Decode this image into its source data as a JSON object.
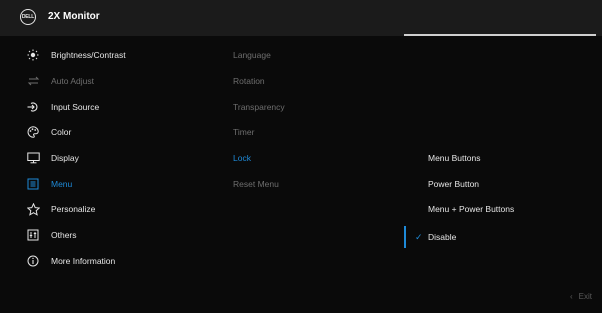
{
  "header": {
    "logo_text": "DELL",
    "title": "2X Monitor"
  },
  "main_menu": [
    {
      "label": "Brightness/Contrast",
      "icon": "brightness-icon",
      "state": "normal"
    },
    {
      "label": "Auto Adjust",
      "icon": "auto-adjust-icon",
      "state": "disabled"
    },
    {
      "label": "Input Source",
      "icon": "input-source-icon",
      "state": "normal"
    },
    {
      "label": "Color",
      "icon": "color-palette-icon",
      "state": "normal"
    },
    {
      "label": "Display",
      "icon": "display-icon",
      "state": "normal"
    },
    {
      "label": "Menu",
      "icon": "menu-icon",
      "state": "selected"
    },
    {
      "label": "Personalize",
      "icon": "star-icon",
      "state": "normal"
    },
    {
      "label": "Others",
      "icon": "others-icon",
      "state": "normal"
    },
    {
      "label": "More Information",
      "icon": "info-icon",
      "state": "normal"
    }
  ],
  "submenu": [
    {
      "label": "Language",
      "state": "dim"
    },
    {
      "label": "Rotation",
      "state": "dim"
    },
    {
      "label": "Transparency",
      "state": "dim"
    },
    {
      "label": "Timer",
      "state": "dim"
    },
    {
      "label": "Lock",
      "state": "selected"
    },
    {
      "label": "Reset Menu",
      "state": "dim"
    }
  ],
  "lock_options": [
    {
      "label": "Menu Buttons",
      "state": "normal"
    },
    {
      "label": "Power Button",
      "state": "normal"
    },
    {
      "label": "Menu + Power Buttons",
      "state": "normal"
    },
    {
      "label": "Disable",
      "state": "checked"
    }
  ],
  "footer": {
    "exit_label": "Exit"
  },
  "colors": {
    "accent": "#1e8ad8",
    "background": "#0a0a0a",
    "header": "#1b1b1b",
    "text": "#e6e6e6",
    "dim_text": "#6e6e6e"
  }
}
